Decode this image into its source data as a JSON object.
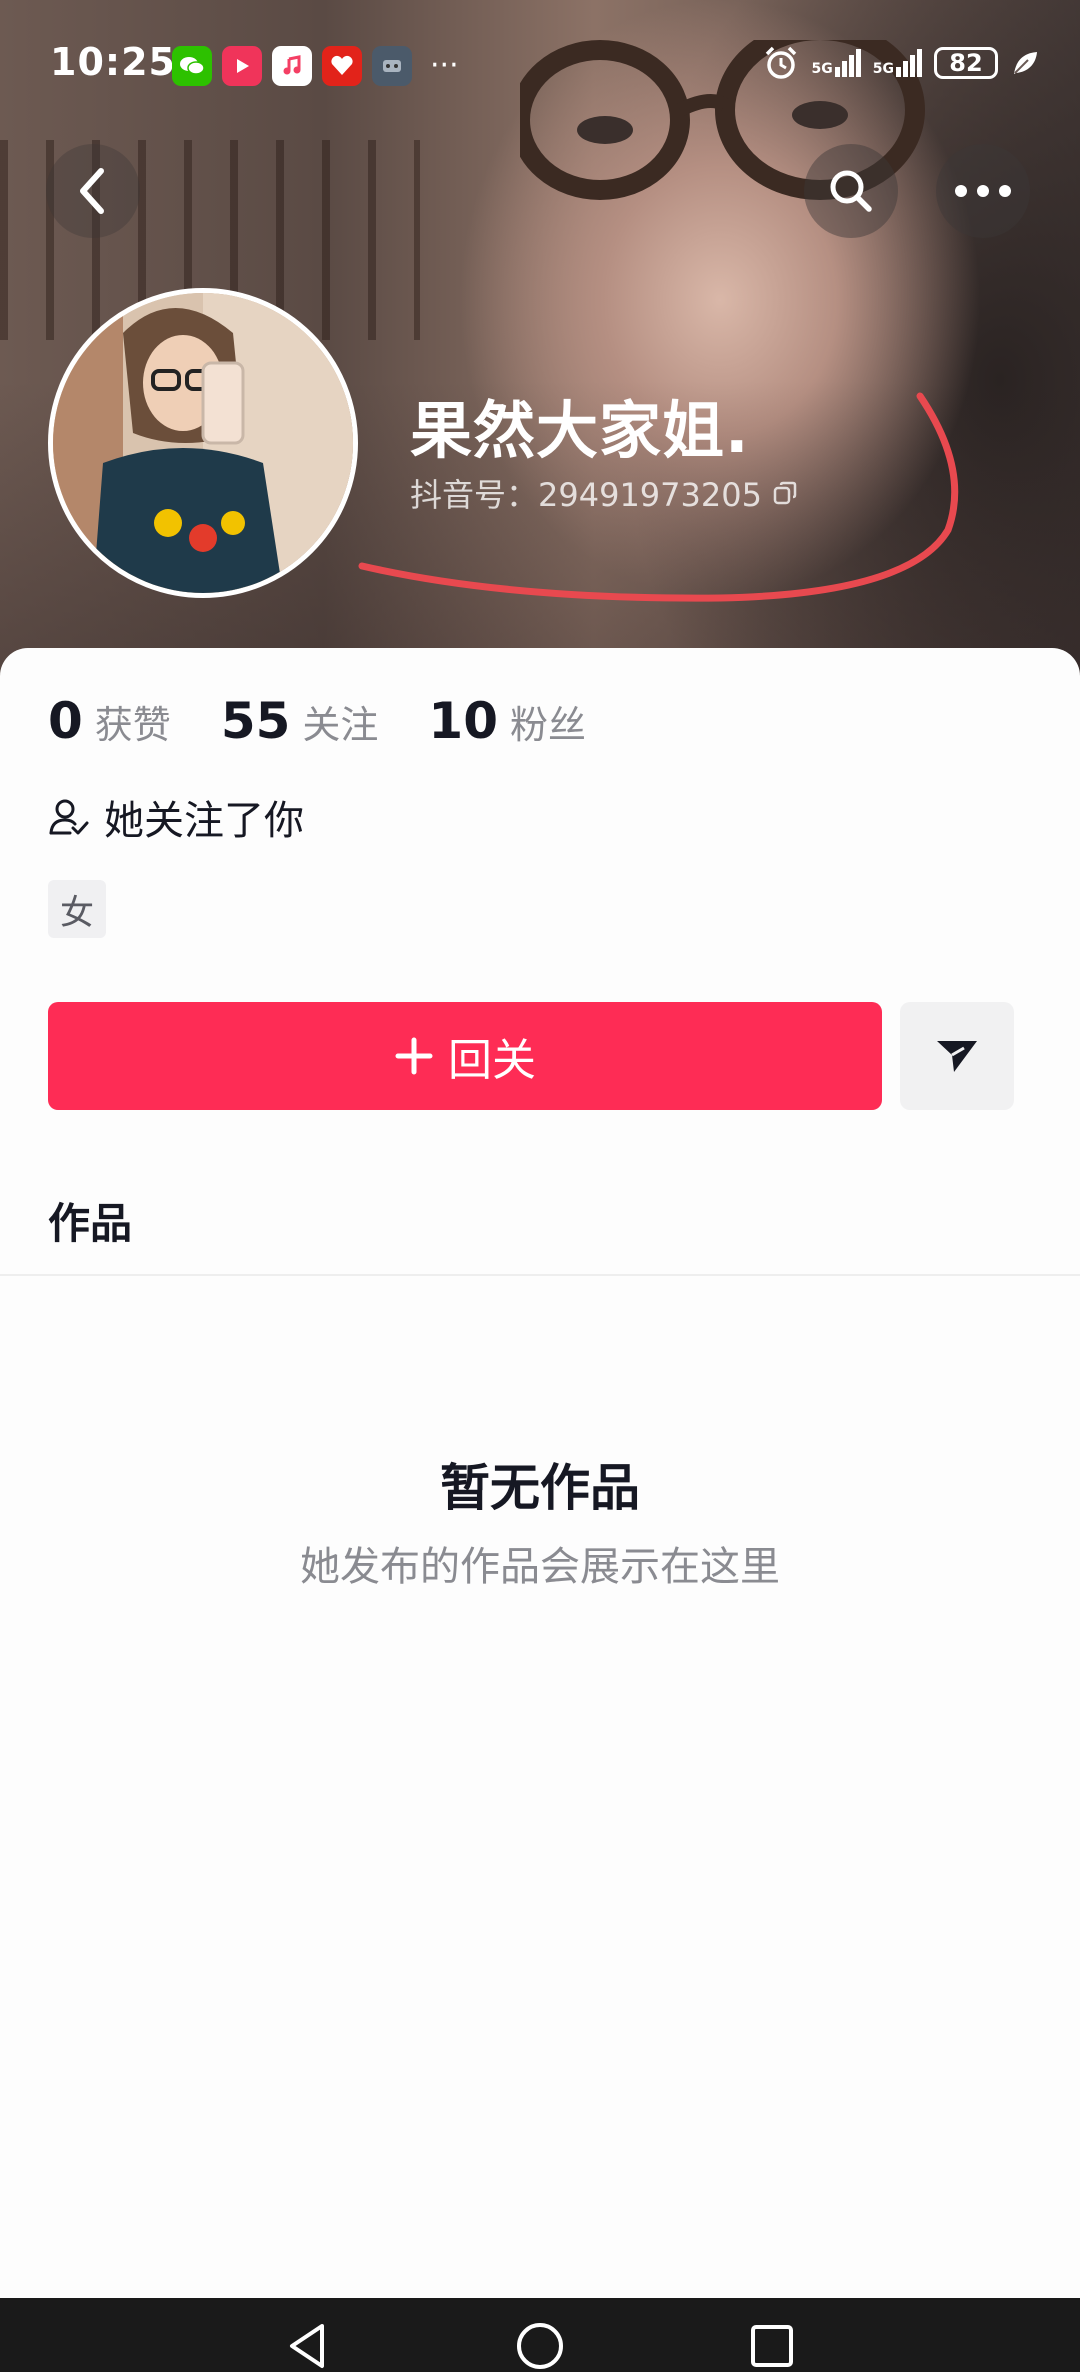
{
  "status_bar": {
    "time": "10:25",
    "network_1": "5G",
    "network_2": "5G",
    "battery": "82"
  },
  "profile": {
    "username": "果然大家姐.",
    "douyin_id": "抖音号：29491973205",
    "stats": [
      {
        "value": "0",
        "label": "获赞"
      },
      {
        "value": "55",
        "label": "关注"
      },
      {
        "value": "10",
        "label": "粉丝"
      }
    ],
    "follows_you": "她关注了你",
    "gender": "女"
  },
  "actions": {
    "follow_back": "回关"
  },
  "tabs": {
    "works": "作品"
  },
  "empty_state": {
    "title": "暂无作品",
    "subtitle": "她发布的作品会展示在这里"
  },
  "colors": {
    "accent": "#fe2c55",
    "annotation": "#e8494f"
  }
}
